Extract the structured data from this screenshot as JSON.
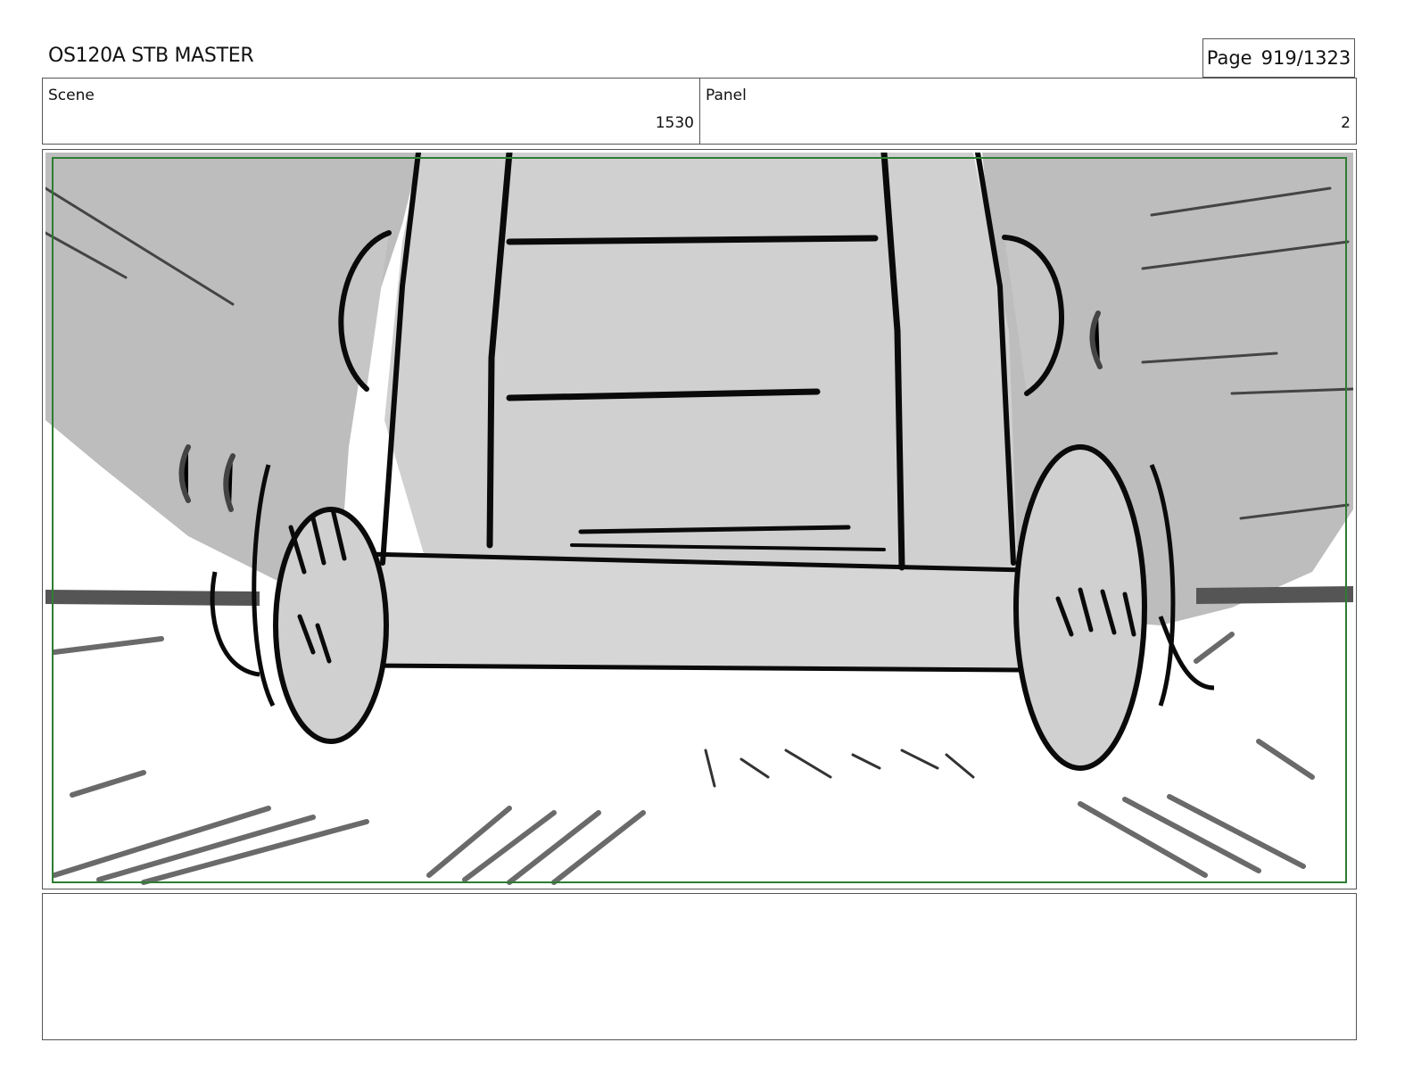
{
  "header": {
    "title": "OS120A STB MASTER",
    "page_label": "Page",
    "page_value": "919/1323"
  },
  "info": {
    "scene_label": "Scene",
    "scene_value": "1530",
    "panel_label": "Panel",
    "panel_value": "2"
  },
  "colors": {
    "safe_area_border": "#2e7d32",
    "sky_gray": "#b8b8b8",
    "body_gray": "#cfcfcf",
    "ink": "#0a0a0a"
  },
  "notes": {
    "text": ""
  }
}
